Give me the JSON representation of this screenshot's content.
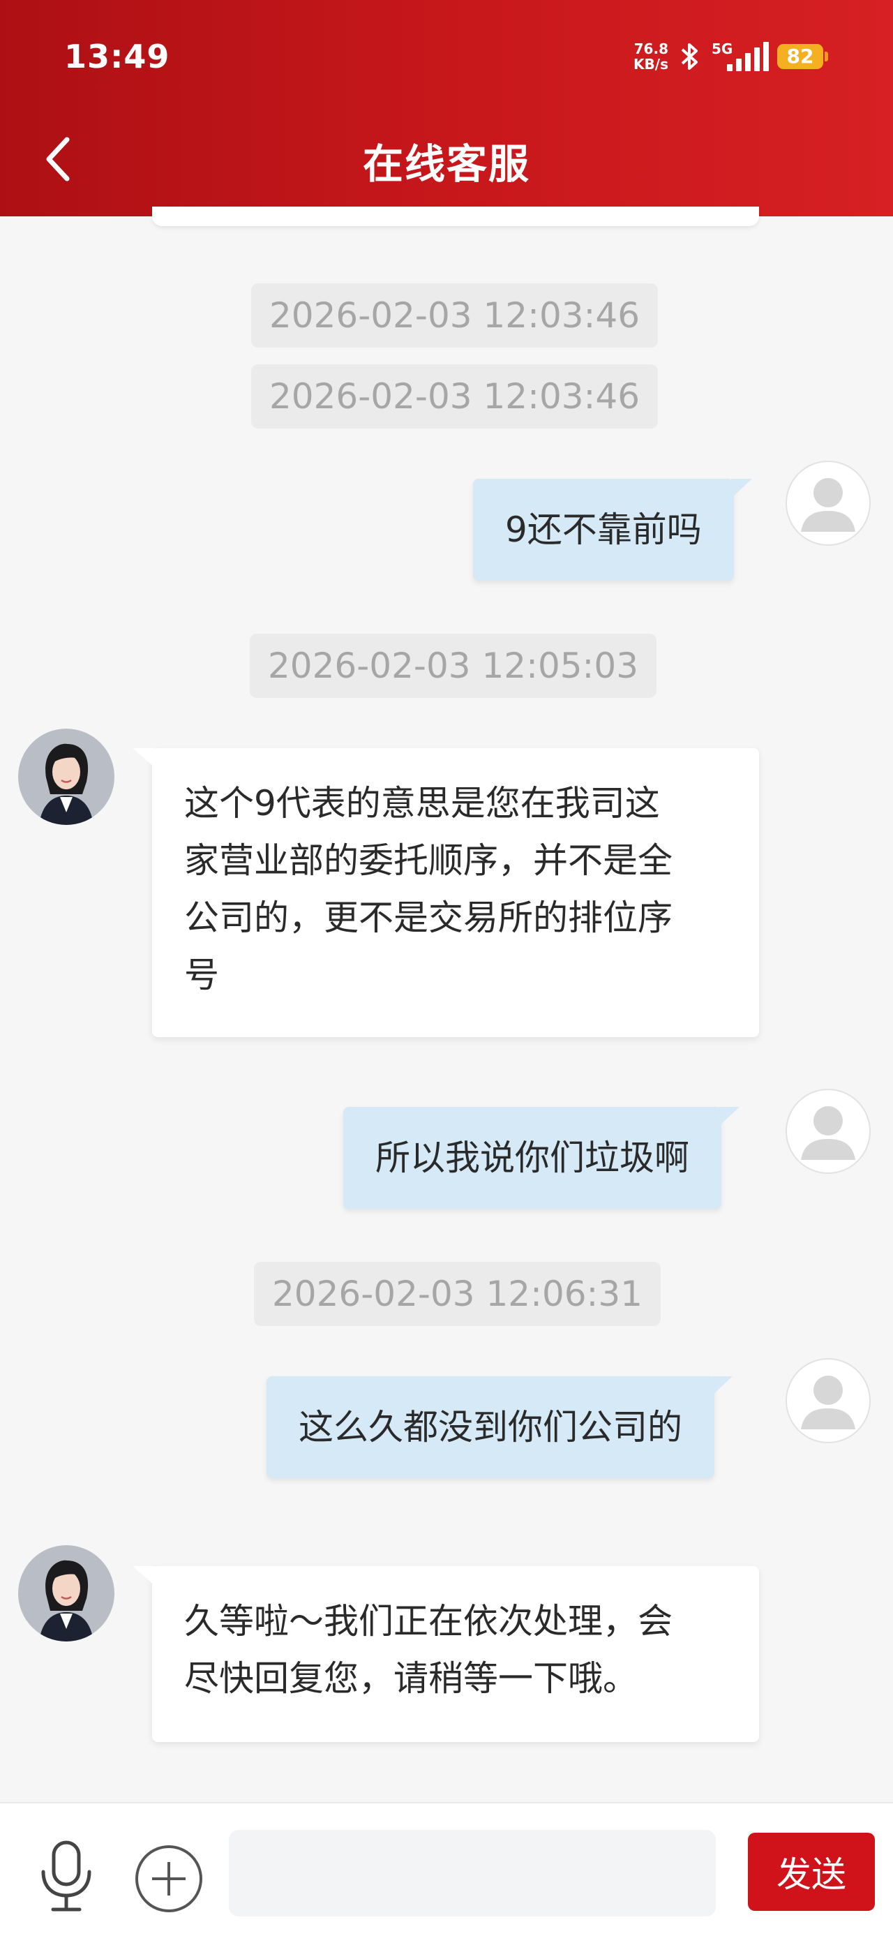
{
  "status_bar": {
    "time": "13:49",
    "net_speed_value": "76.8",
    "net_speed_unit": "KB/s",
    "network": "5G",
    "battery": "82"
  },
  "header": {
    "title": "在线客服"
  },
  "messages": [
    {
      "type": "timestamp",
      "text": "2026-02-03 12:03:46"
    },
    {
      "type": "timestamp",
      "text": "2026-02-03 12:03:46"
    },
    {
      "type": "user",
      "text": "9还不靠前吗"
    },
    {
      "type": "timestamp",
      "text": "2026-02-03 12:05:03"
    },
    {
      "type": "agent",
      "lines": [
        "这个9代表的意思是您在我司这",
        "家营业部的委托顺序，并不是全",
        "公司的，更不是交易所的排位序",
        "号"
      ]
    },
    {
      "type": "user",
      "text": "所以我说你们垃圾啊"
    },
    {
      "type": "timestamp",
      "text": "2026-02-03 12:06:31"
    },
    {
      "type": "user",
      "text": "这么久都没到你们公司的"
    },
    {
      "type": "agent",
      "lines": [
        "久等啦～我们正在依次处理，会",
        "尽快回复您，请稍等一下哦。"
      ]
    }
  ],
  "input_bar": {
    "placeholder": "",
    "send_label": "发送"
  },
  "icons": {
    "back": "back-arrow-icon",
    "mic": "microphone-icon",
    "plus": "plus-circle-icon",
    "bluetooth": "bluetooth-icon",
    "signal": "signal-icon",
    "battery": "battery-icon"
  },
  "colors": {
    "header": "#c9181c",
    "send_button": "#d0121a",
    "user_bubble": "#d6e9f7",
    "agent_bubble": "#ffffff",
    "timestamp_bg": "#ebebeb"
  }
}
